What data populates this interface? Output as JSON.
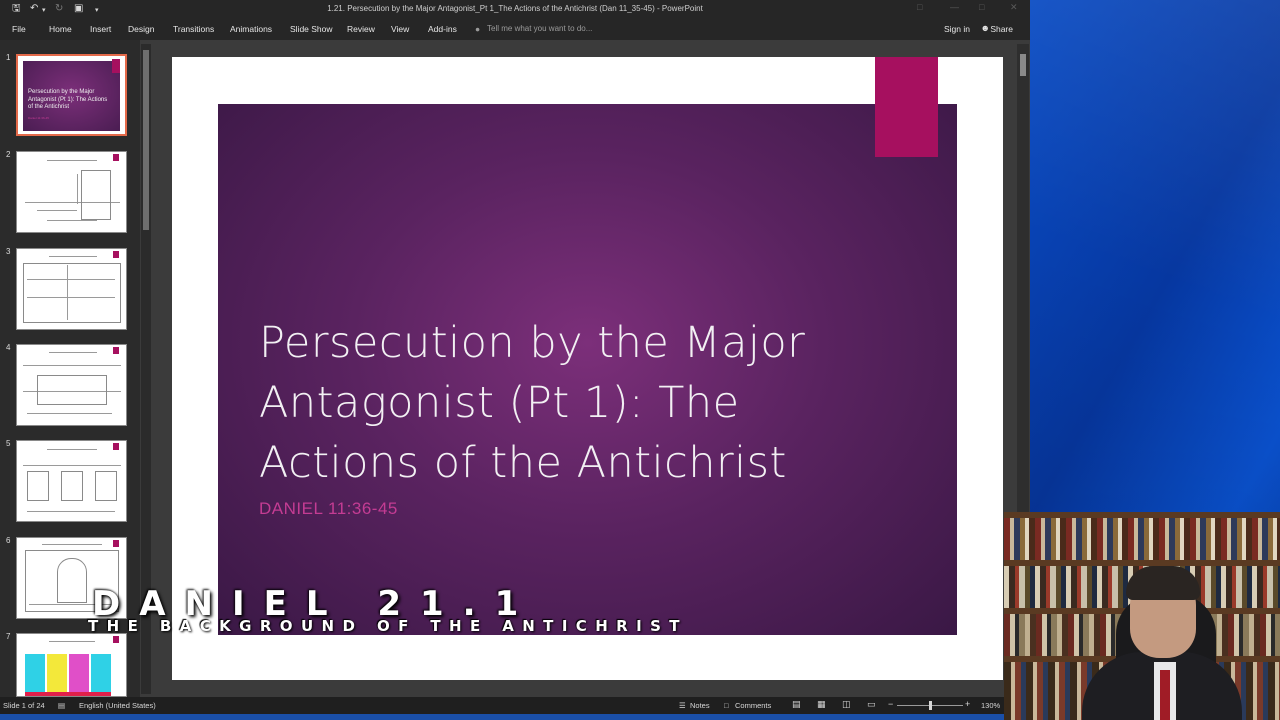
{
  "window": {
    "title": "1.21. Persecution by the Major Antagonist_Pt 1_The Actions of the Antichrist (Dan 11_35-45) - PowerPoint"
  },
  "ribbon": {
    "tabs": [
      "File",
      "Home",
      "Insert",
      "Design",
      "Transitions",
      "Animations",
      "Slide Show",
      "Review",
      "View",
      "Add-ins"
    ],
    "tell_me_placeholder": "Tell me what you want to do...",
    "sign_in": "Sign in",
    "share": "Share"
  },
  "thumbnails": {
    "numbers": [
      "1",
      "2",
      "3",
      "4",
      "5",
      "6",
      "7"
    ],
    "slide1_title": "Persecution by the Major Antagonist (Pt 1): The Actions of the Antichrist",
    "slide1_sub": "Daniel 11:36-45"
  },
  "slide": {
    "title_lines": [
      "Persecution by the Major",
      "Antagonist (Pt 1): The",
      "Actions of the Antichrist"
    ],
    "subtitle": "DANIEL 11:36-45",
    "colors": {
      "accent": "#a6105f",
      "background": "#5a2360",
      "subtitle": "#c43c93"
    }
  },
  "overlay": {
    "title": "DANIEL 21.1",
    "subtitle": "THE BACKGROUND OF THE ANTICHRIST"
  },
  "statusbar": {
    "slide_info": "Slide 1 of 24",
    "language": "English (United States)",
    "notes": "Notes",
    "comments": "Comments",
    "zoom": "130%"
  }
}
